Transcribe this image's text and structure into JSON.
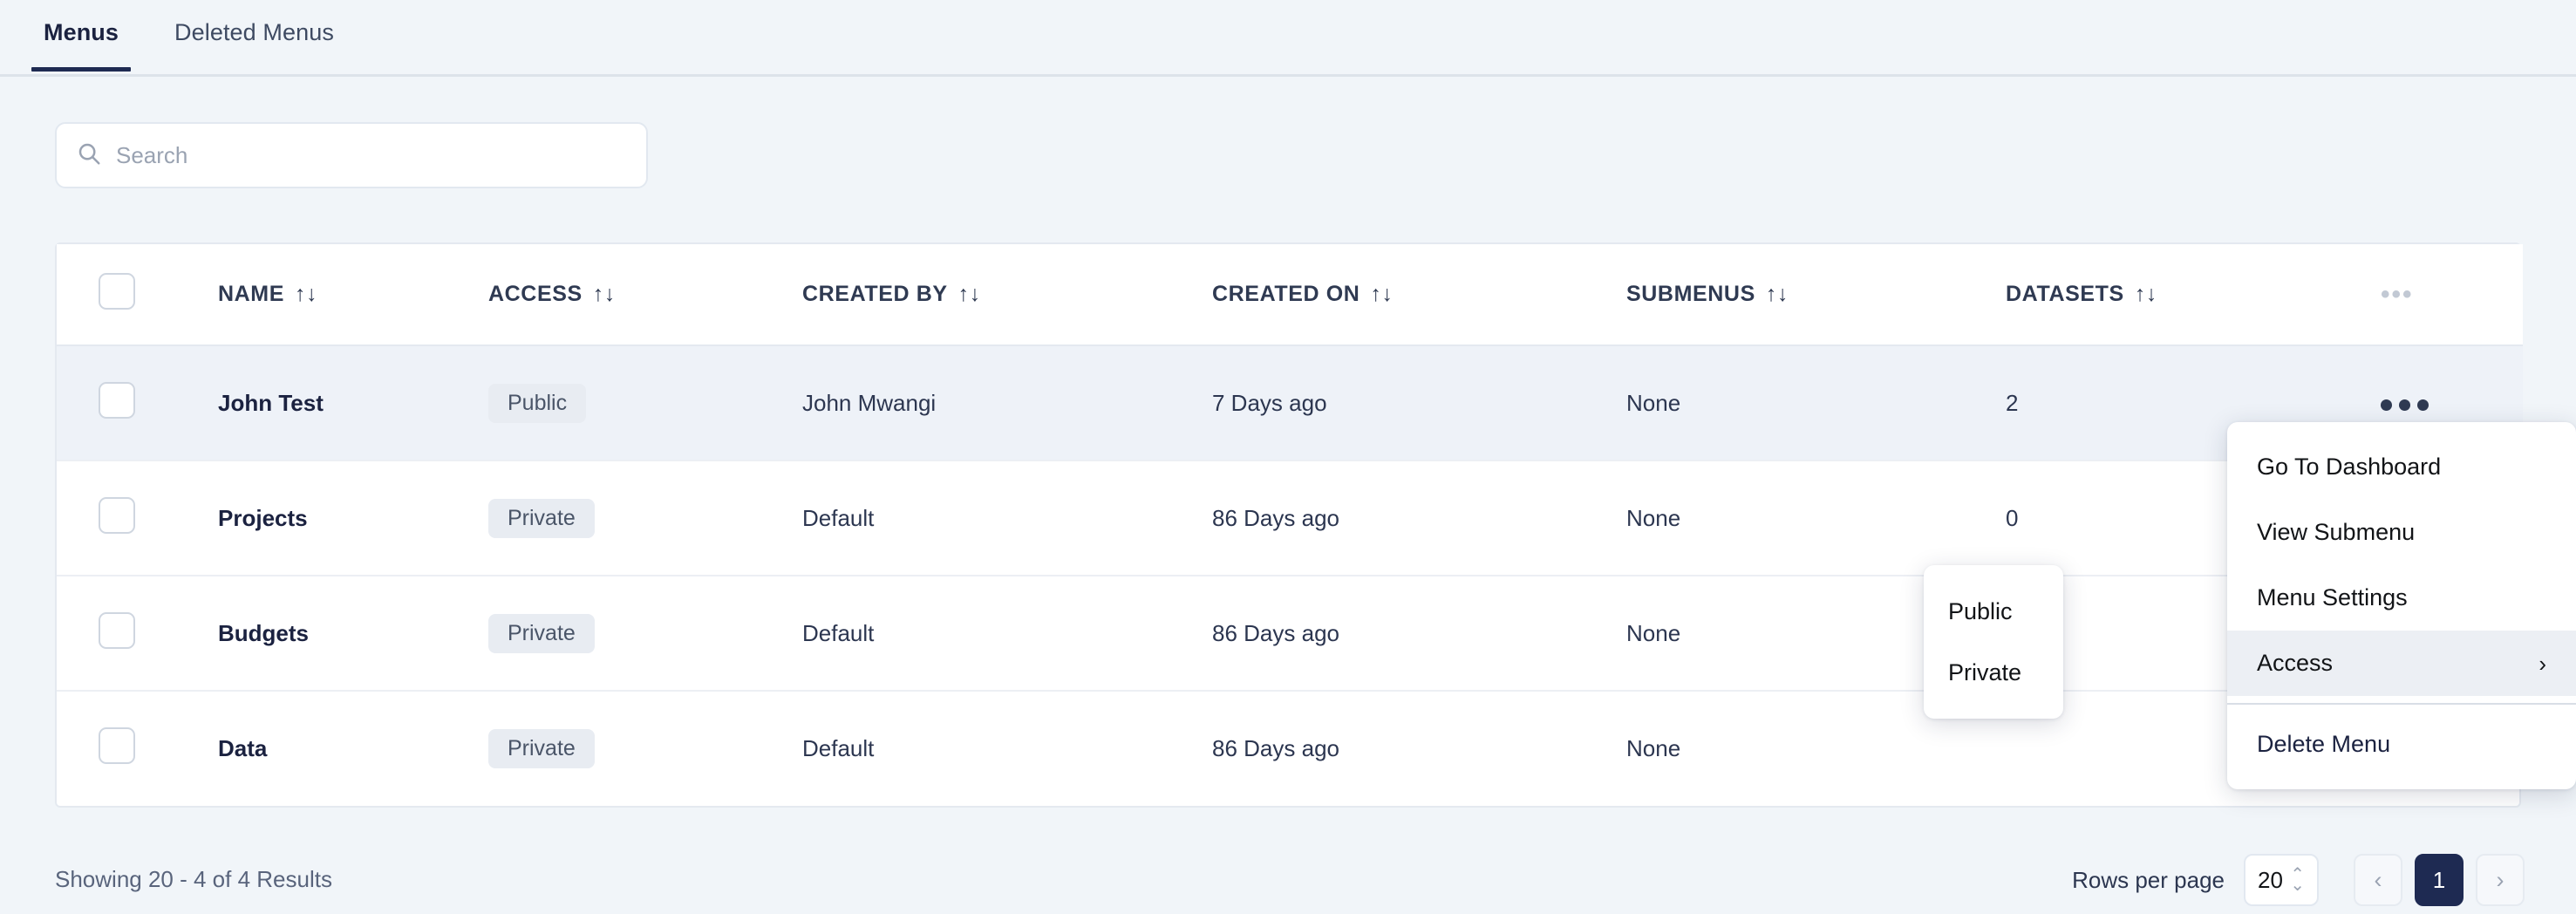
{
  "tabs": [
    {
      "label": "Menus",
      "active": true
    },
    {
      "label": "Deleted Menus",
      "active": false
    }
  ],
  "search": {
    "placeholder": "Search",
    "value": "",
    "icon": "search-icon"
  },
  "table": {
    "columns": [
      {
        "key": "checkbox",
        "label": "",
        "sortable": false
      },
      {
        "key": "name",
        "label": "NAME",
        "sortable": true
      },
      {
        "key": "access",
        "label": "ACCESS",
        "sortable": true
      },
      {
        "key": "created_by",
        "label": "CREATED BY",
        "sortable": true
      },
      {
        "key": "created_on",
        "label": "CREATED ON",
        "sortable": true
      },
      {
        "key": "submenus",
        "label": "SUBMENUS",
        "sortable": true
      },
      {
        "key": "datasets",
        "label": "DATASETS",
        "sortable": true
      },
      {
        "key": "actions",
        "label": "•••",
        "sortable": false
      }
    ],
    "sort_glyph": "↑↓",
    "rows": [
      {
        "name": "John Test",
        "access": "Public",
        "created_by": "John Mwangi",
        "created_on": "7 Days ago",
        "submenus": "None",
        "datasets": "2",
        "hovered": true
      },
      {
        "name": "Projects",
        "access": "Private",
        "created_by": "Default",
        "created_on": "86 Days ago",
        "submenus": "None",
        "datasets": "0",
        "hovered": false
      },
      {
        "name": "Budgets",
        "access": "Private",
        "created_by": "Default",
        "created_on": "86 Days ago",
        "submenus": "None",
        "datasets": "",
        "hovered": false
      },
      {
        "name": "Data",
        "access": "Private",
        "created_by": "Default",
        "created_on": "86 Days ago",
        "submenus": "None",
        "datasets": "",
        "hovered": false
      }
    ]
  },
  "row_menu": {
    "items": [
      {
        "label": "Go To Dashboard",
        "active": false,
        "has_submenu": false
      },
      {
        "label": "View Submenu",
        "active": false,
        "has_submenu": false
      },
      {
        "label": "Menu Settings",
        "active": false,
        "has_submenu": false
      },
      {
        "label": "Access",
        "active": true,
        "has_submenu": true
      },
      {
        "label": "Delete Menu",
        "active": false,
        "has_submenu": false
      }
    ],
    "chevron": "›"
  },
  "access_submenu": {
    "items": [
      {
        "label": "Public"
      },
      {
        "label": "Private"
      }
    ]
  },
  "footer": {
    "showing": "Showing 20 - 4 of 4 Results",
    "rows_per_page_label": "Rows per page",
    "rows_per_page_value": "20",
    "prev_glyph": "‹",
    "next_glyph": "›",
    "current_page": "1"
  },
  "colors": {
    "page_bg": "#f1f5f9",
    "accent": "#1e2a52",
    "text": "#2c3650",
    "muted": "#9aa3b2",
    "row_hover": "#eef2f8",
    "badge_bg": "#e8ecf2"
  }
}
